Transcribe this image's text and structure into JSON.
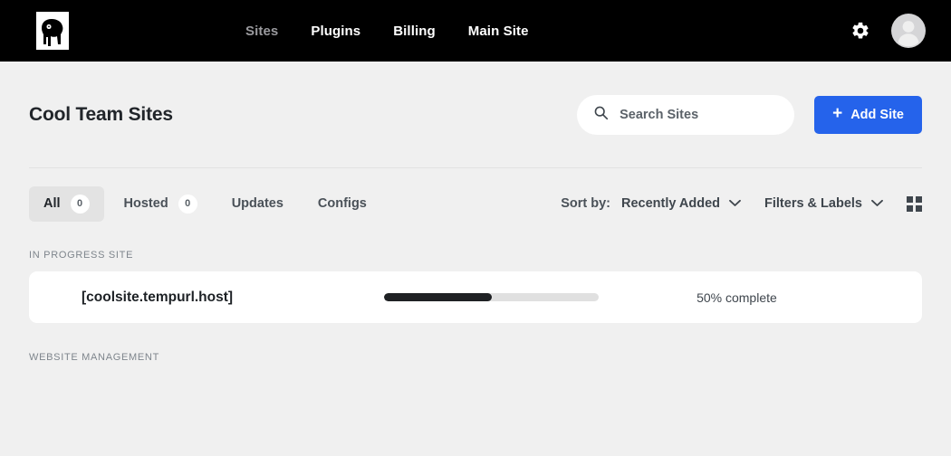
{
  "topbar": {
    "logo_name": "gorilla-logo",
    "nav": [
      {
        "label": "Sites",
        "active": true
      },
      {
        "label": "Plugins",
        "active": false
      },
      {
        "label": "Billing",
        "active": false
      },
      {
        "label": "Main Site",
        "active": false
      }
    ],
    "settings_icon": "gear-icon",
    "avatar_icon": "user-avatar-icon",
    "background": "#000000"
  },
  "header": {
    "title": "Cool Team Sites",
    "search": {
      "placeholder": "Search Sites",
      "value": "",
      "icon": "search-icon"
    },
    "add_button": {
      "label": "Add Site",
      "plus": "+",
      "color": "#2563eb"
    }
  },
  "toolbar": {
    "tabs": [
      {
        "label": "All",
        "count": "0",
        "active": true
      },
      {
        "label": "Hosted",
        "count": "0",
        "active": false
      },
      {
        "label": "Updates",
        "count": "",
        "active": false
      },
      {
        "label": "Configs",
        "count": "",
        "active": false
      }
    ],
    "sort_label": "Sort by:",
    "sort_value": "Recently Added",
    "filters_label": "Filters & Labels",
    "grid_view_icon": "grid-view-icon"
  },
  "sections": {
    "in_progress_label": "IN PROGRESS SITE",
    "website_management_label": "WEBSITE MANAGEMENT"
  },
  "site_card": {
    "name": "[coolsite.tempurl.host]",
    "progress_percent": 50,
    "progress_width": "50%",
    "progress_text": "50% complete",
    "fill_color": "#1f2124",
    "track_color": "#e0e0e0"
  }
}
